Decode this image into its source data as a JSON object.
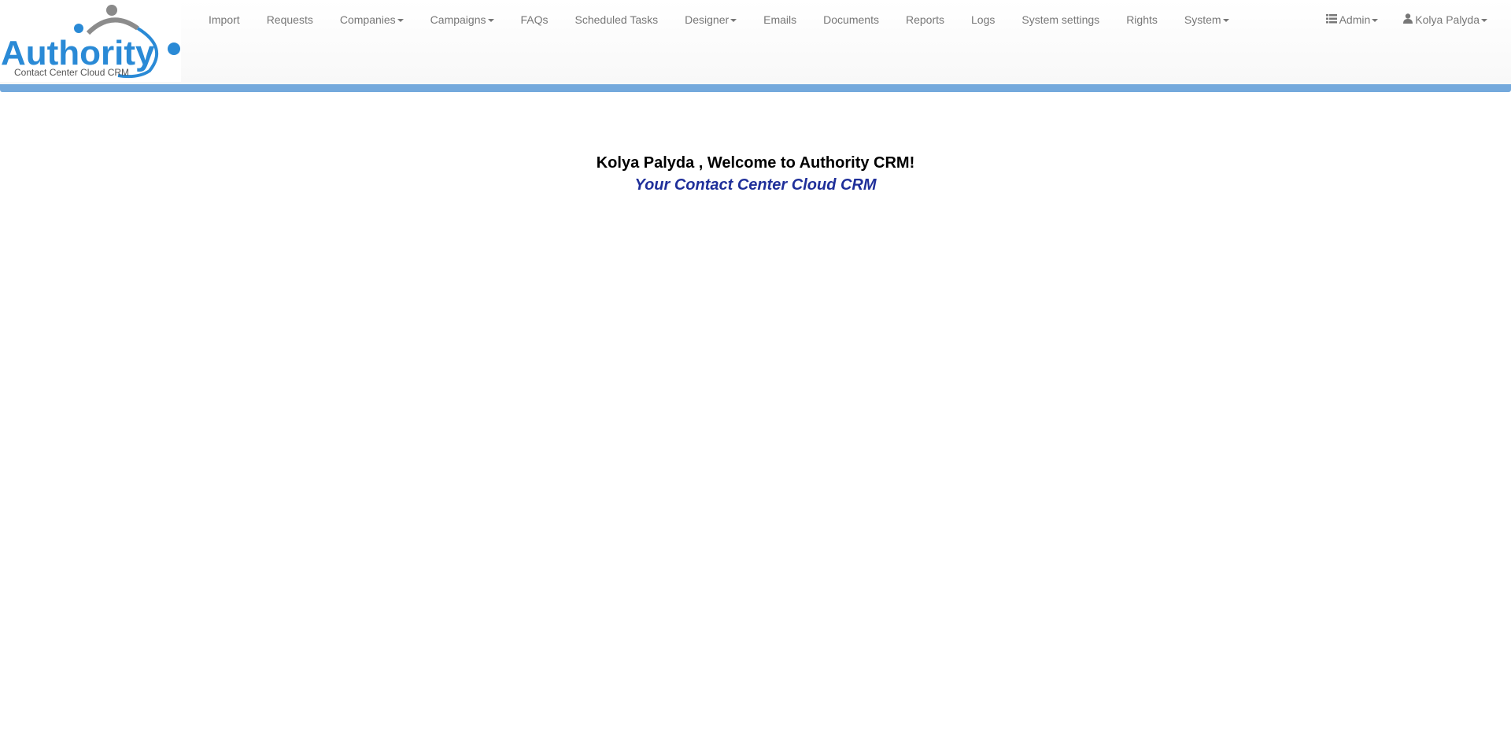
{
  "logo": {
    "text": "Authority",
    "tagline": "Contact Center Cloud CRM"
  },
  "nav": {
    "items": [
      {
        "label": "Import",
        "dropdown": false
      },
      {
        "label": "Requests",
        "dropdown": false
      },
      {
        "label": "Companies",
        "dropdown": true
      },
      {
        "label": "Campaigns",
        "dropdown": true
      },
      {
        "label": "FAQs",
        "dropdown": false
      },
      {
        "label": "Scheduled Tasks",
        "dropdown": false
      },
      {
        "label": "Designer",
        "dropdown": true
      },
      {
        "label": "Emails",
        "dropdown": false
      },
      {
        "label": "Documents",
        "dropdown": false
      },
      {
        "label": "Reports",
        "dropdown": false
      },
      {
        "label": "Logs",
        "dropdown": false
      },
      {
        "label": "System settings",
        "dropdown": false
      },
      {
        "label": "Rights",
        "dropdown": false
      },
      {
        "label": "System",
        "dropdown": true
      }
    ],
    "right": {
      "admin_label": "Admin",
      "admin_icon": "list-icon",
      "user_label": "Kolya Palyda",
      "user_icon": "user-icon"
    }
  },
  "welcome": {
    "title": "Kolya Palyda , Welcome to Authority CRM!",
    "subtitle": "Your Contact Center Cloud CRM"
  },
  "colors": {
    "brand_blue": "#2a8ad6",
    "strip": "#74a9dc",
    "subtitle": "#1f2f9a",
    "nav_text": "#777777"
  }
}
